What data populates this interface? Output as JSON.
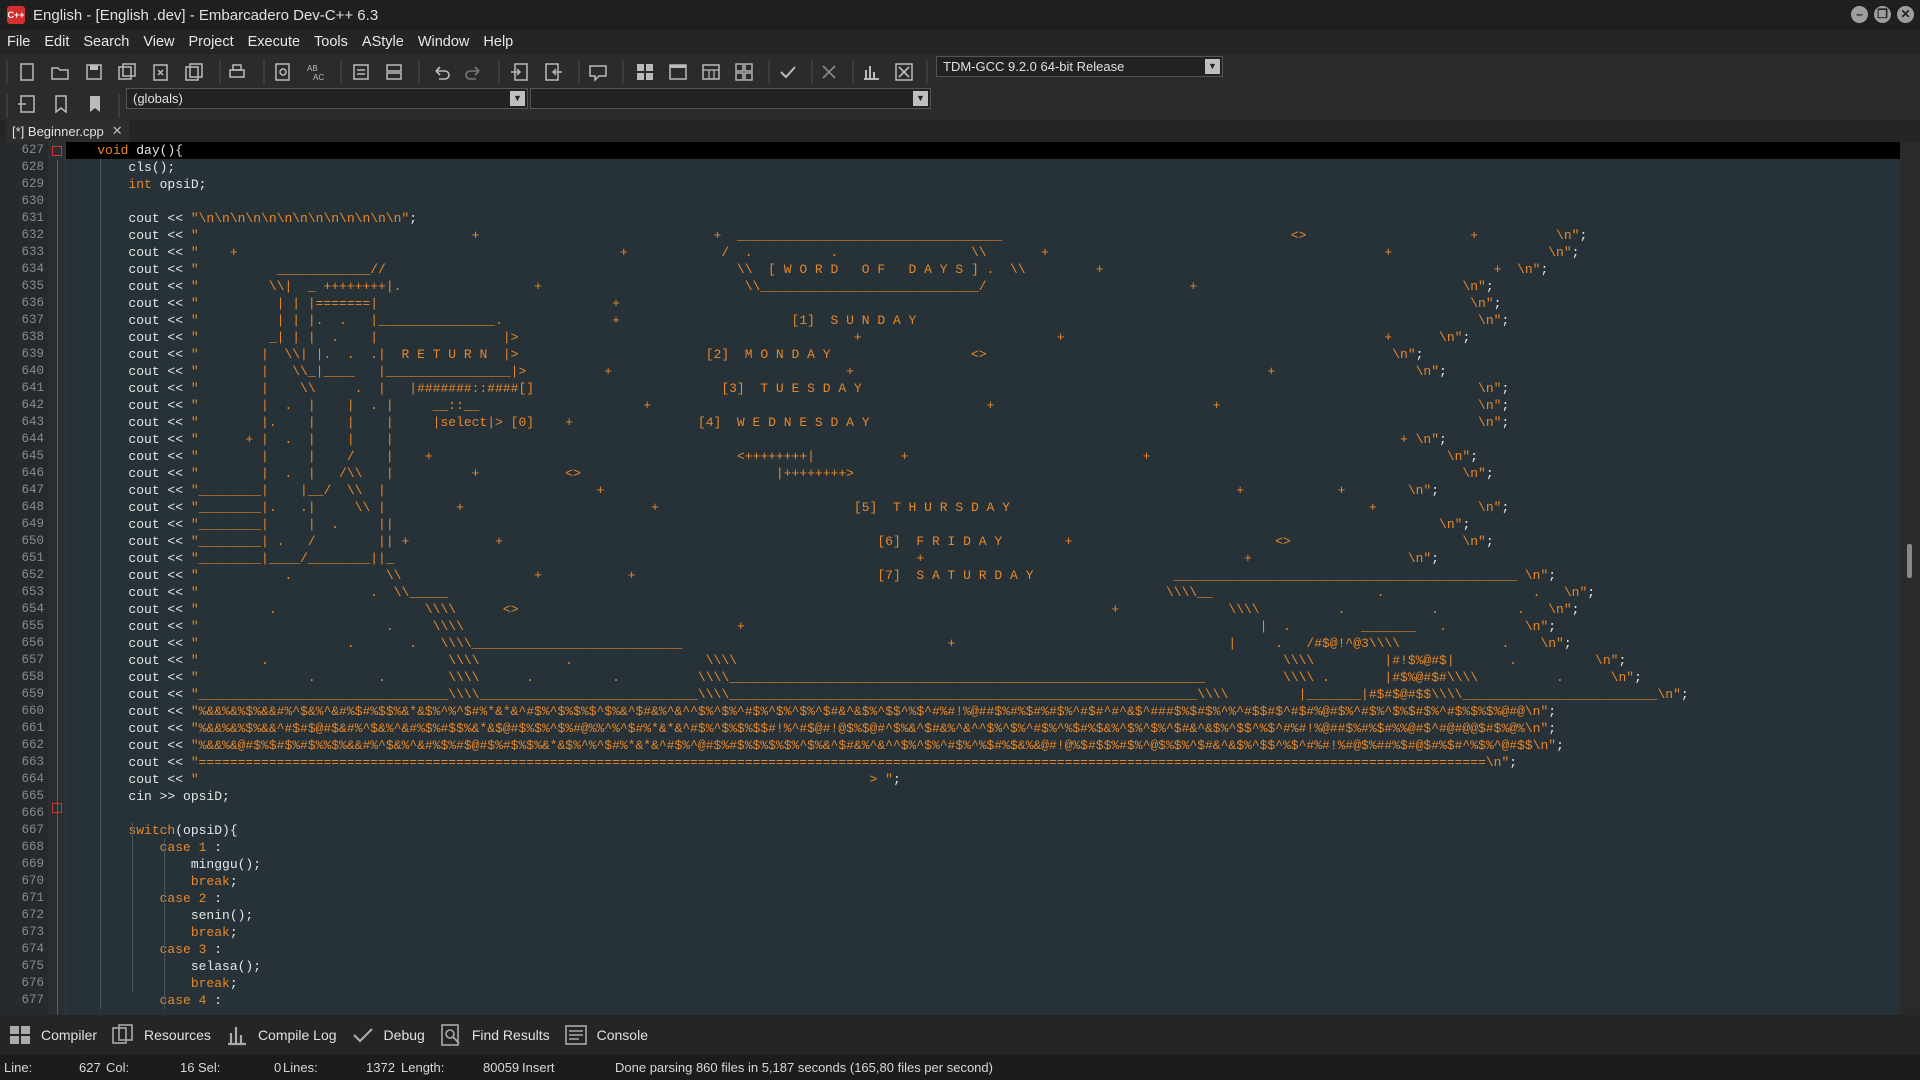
{
  "window": {
    "title": "English - [English .dev] - Embarcadero Dev-C++ 6.3",
    "icon_text": "C++",
    "buttons": [
      "minimize-icon",
      "restore-icon",
      "close-icon"
    ]
  },
  "menu": [
    "File",
    "Edit",
    "Search",
    "View",
    "Project",
    "Execute",
    "Tools",
    "AStyle",
    "Window",
    "Help"
  ],
  "toolbar": {
    "compiler_select": "TDM-GCC 9.2.0 64-bit Release",
    "scope_select": "(globals)",
    "second_select": "",
    "icons": [
      "new-file-icon",
      "open-icon",
      "save-icon",
      "save-all-icon",
      "close-file-icon",
      "close-all-icon",
      "print-icon",
      "find-icon",
      "replace-icon",
      "indent-icon",
      "unindent-icon",
      "undo-icon",
      "redo-icon",
      "goto-icon",
      "bookmark-icon",
      "comment-icon",
      "layout-icon",
      "window-icon",
      "class-view-icon",
      "grid-icon",
      "check-icon",
      "stop-icon",
      "chart-icon",
      "delete-icon"
    ]
  },
  "tabs": [
    {
      "label": "[*] Beginner.cpp",
      "close": "✕"
    }
  ],
  "editor": {
    "lines": [
      {
        "n": "627",
        "t": "    void day(){"
      },
      {
        "n": "628",
        "t": "        cls();"
      },
      {
        "n": "629",
        "t": "        int opsiD;"
      },
      {
        "n": "630",
        "t": ""
      },
      {
        "n": "631",
        "t": "        cout << \"\\n\\n\\n\\n\\n\\n\\n\\n\\n\\n\\n\\n\\n\";"
      },
      {
        "n": "632",
        "t": "        cout << \"                                   +                              +  __________________________________                                     <>                     +          \\n\";"
      },
      {
        "n": "633",
        "t": "        cout << \"    +                                                 +            /  .          .                 \\\\       +                                           +                    \\n\";"
      },
      {
        "n": "634",
        "t": "        cout << \"          ____________//                                             \\\\  [ W O R D   O F   D A Y S ] .  \\\\         +                                                  +  \\n\";"
      },
      {
        "n": "635",
        "t": "        cout << \"         \\\\|  _ ++++++++|.                 +                          \\\\____________________________/                          +                                  \\n\";"
      },
      {
        "n": "636",
        "t": "        cout << \"          | | |=======|                              +                                                                                                             \\n\";"
      },
      {
        "n": "637",
        "t": "        cout << \"          | | |.  .   |_______________.              +                      [1]  S U N D A Y                                                                        \\n\";"
      },
      {
        "n": "638",
        "t": "        cout << \"         _| | |  .    |                |>                                           +                         +                                         +      \\n\";"
      },
      {
        "n": "639",
        "t": "        cout << \"        |  \\\\| |.  .  .|  R E T U R N  |>                        [2]  M O N D A Y                  <>                                                    \\n\";"
      },
      {
        "n": "640",
        "t": "        cout << \"        |   \\\\_|____   |________________|>          +                              +                                                     +                  \\n\";"
      },
      {
        "n": "641",
        "t": "        cout << \"        |    \\\\     .  |   |#######::####[]                        [3]  T U E S D A Y                                                                               \\n\";"
      },
      {
        "n": "642",
        "t": "        cout << \"        |  .  |    |  . |     __::__                     +                                           +                            +                                 \\n\";"
      },
      {
        "n": "643",
        "t": "        cout << \"        |.    |    |    |     |select|> [0]    +                [4]  W E D N E S D A Y                                                                              \\n\";"
      },
      {
        "n": "644",
        "t": "        cout << \"      + |  .  |    |    |                                                                                                                                 + \\n\";"
      },
      {
        "n": "645",
        "t": "        cout << \"        |     |    /    |    +                                       <++++++++|           +                              +                                      \\n\";"
      },
      {
        "n": "646",
        "t": "        cout << \"        |  .  |   /\\\\   |          +           <>                         |++++++++>                                                                              \\n\";"
      },
      {
        "n": "647",
        "t": "        cout << \"________|    |__/  \\\\  |                           +                                                                                 +            +        \\n\";"
      },
      {
        "n": "648",
        "t": "        cout << \"________|.   .|     \\\\ |         +                        +                         [5]  T H U R S D A Y                                              +             \\n\";"
      },
      {
        "n": "649",
        "t": "        cout << \"________|     |  .     ||                                                                                                                                      \\n\";"
      },
      {
        "n": "650",
        "t": "        cout << \"________| .   /        || +           +                                                [6]  F R I D A Y        +                          <>                      \\n\";"
      },
      {
        "n": "651",
        "t": "        cout << \"________|____/________||_                                                                   +                                         +                    \\n\";"
      },
      {
        "n": "652",
        "t": "        cout << \"           .            \\\\                 +           +                               [7]  S A T U R D A Y                  ____________________________________________ \\n\";"
      },
      {
        "n": "653",
        "t": "        cout << \"                      .  \\\\_____                                                                                            \\\\\\\\__                     .                   .   \\n\";"
      },
      {
        "n": "654",
        "t": "        cout << \"         .                   \\\\\\\\      <>                                                                            +              \\\\\\\\          .           .          .   \\n\";"
      },
      {
        "n": "655",
        "t": "        cout << \"                        .     \\\\\\\\                                   +                                                                  |  .         _______   .          \\n\";"
      },
      {
        "n": "656",
        "t": "        cout << \"                   .       .   \\\\\\\\___________________________                                  +                                   |     .   /#$@!^@3\\\\\\\\             .    \\n\";"
      },
      {
        "n": "657",
        "t": "        cout << \"        .                       \\\\\\\\           .                 \\\\\\\\                                                                      \\\\\\\\         |#!$%@#$|       .          \\n\";"
      },
      {
        "n": "658",
        "t": "        cout << \"              .        .        \\\\\\\\      .          .          \\\\\\\\_____________________________________________________________          \\\\\\\\ .       |#$%@#$#\\\\\\\\          .      \\n\";"
      },
      {
        "n": "659",
        "t": "        cout << \"________________________________\\\\\\\\____________________________\\\\\\\\____________________________________________________________\\\\\\\\         |_______|#$#$@#$$\\\\\\\\_________________________\\n\";"
      },
      {
        "n": "660",
        "t": "        cout << \"%&&%&%$%&&#%^$&%^&#%$#%$$%&*&$%^%^$#%*&*&^#$%^$%$%$^$%&^$#&%^&^^$%^$%^#$%^$%^$%^$#&^&$%^$$^%$^#%#!%@##$%#%$#%#$%^#$#^#^&$^###$%$#$%^%^#$$#$^#$#%@#$%^#$%^$%$#$%^#$%$%$%@#@\\n\";"
      },
      {
        "n": "661",
        "t": "        cout << \"%&&%&%$%&&^#$#$@#$&#%^$&%^&#%$%#$$%&*&$@#$%$%^$%#@%%^%^$#%*&*&^#$%^$%$%$$#!%^#$@#!@$%$@#^$%&^$#&%^&^^$%^$%^#$%^%$#%$&%^$%^$%^$#&^&$%^$$^%$^#%#!%@##$%#%$#%%@#$^#@#@@$#$%@%\\n\";"
      },
      {
        "n": "662",
        "t": "        cout << \"%&&%&@#$%$#$%#$%%$%&&#%^$&%^&#%$%#$@#$%#$%$%&*&$%^%^$#%*&*&^#$%^@#$%#$%$%$%$%^$%&^$#&%^&^^$%^$%^#$%^%$#%$&%&@#!@%$#$$%#$%^@$%$%^$#&^&$%^$$^%$^#%#!%#@$%##%$#@$#%$#^%$%^@#$$\\n\";"
      },
      {
        "n": "663",
        "t": "        cout << \"=====================================================================================================================================================================\\n\";"
      },
      {
        "n": "664",
        "t": "        cout << \"                                                                                      > \";"
      },
      {
        "n": "665",
        "t": "        cin >> opsiD;"
      },
      {
        "n": "666",
        "t": ""
      },
      {
        "n": "667",
        "t": "        switch(opsiD){"
      },
      {
        "n": "668",
        "t": "            case 1 :"
      },
      {
        "n": "669",
        "t": "                minggu();"
      },
      {
        "n": "670",
        "t": "                break;"
      },
      {
        "n": "671",
        "t": "            case 2 :"
      },
      {
        "n": "672",
        "t": "                senin();"
      },
      {
        "n": "673",
        "t": "                break;"
      },
      {
        "n": "674",
        "t": "            case 3 :"
      },
      {
        "n": "675",
        "t": "                selasa();"
      },
      {
        "n": "676",
        "t": "                break;"
      },
      {
        "n": "677",
        "t": "            case 4 :"
      }
    ]
  },
  "bottom_tabs": [
    {
      "label": "Compiler",
      "icon": "compiler-grid-icon"
    },
    {
      "label": "Resources",
      "icon": "resources-icon"
    },
    {
      "label": "Compile Log",
      "icon": "compile-log-chart-icon"
    },
    {
      "label": "Debug",
      "icon": "debug-check-icon"
    },
    {
      "label": "Find Results",
      "icon": "find-results-icon"
    },
    {
      "label": "Console",
      "icon": "console-icon"
    }
  ],
  "status": {
    "line_label": "Line:",
    "line_value": "627",
    "col_label": "Col:",
    "col_value": "16",
    "sel_label": "Sel:",
    "sel_value": "0",
    "lines_label": "Lines:",
    "lines_value": "1372",
    "length_label": "Length:",
    "length_value": "80059",
    "mode": "Insert",
    "message": "Done parsing 860 files in 5,187 seconds (165,80 files per second)"
  },
  "colors": {
    "string": "#e8872a",
    "keyword": "#e8872a",
    "editor_bg": "#263238",
    "fold_marker": "#d32f2f"
  }
}
